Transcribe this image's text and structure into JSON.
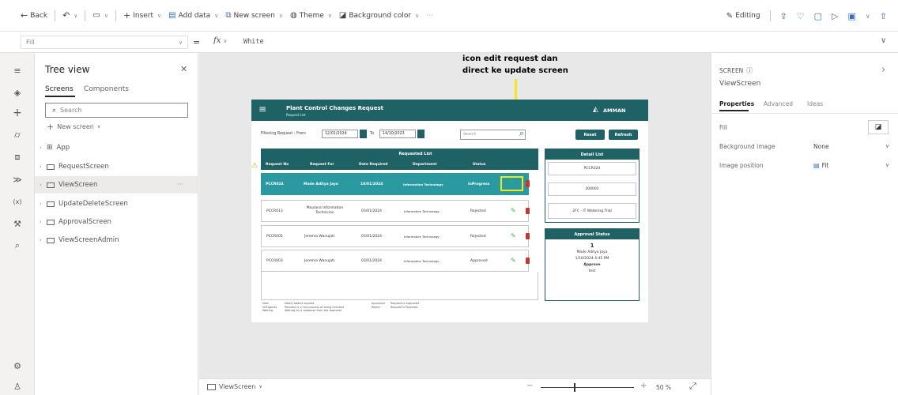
{
  "toolbar": {
    "back": "Back",
    "insert": "Insert",
    "add_data": "Add data",
    "new_screen": "New screen",
    "theme": "Theme",
    "background_color": "Background color",
    "editing": "Editing"
  },
  "formula": {
    "property": "Fill",
    "fx": "fx",
    "value": "White"
  },
  "tree": {
    "title": "Tree view",
    "tab_screens": "Screens",
    "tab_components": "Components",
    "search_placeholder": "Search",
    "new_screen": "New screen",
    "items": [
      {
        "label": "App"
      },
      {
        "label": "RequestScreen"
      },
      {
        "label": "ViewScreen"
      },
      {
        "label": "UpdateDeleteScreen"
      },
      {
        "label": "ApprovalScreen"
      },
      {
        "label": "ViewScreenAdmin"
      }
    ]
  },
  "annotation": {
    "line1": "icon edit request dan",
    "line2": "direct ke update screen"
  },
  "app": {
    "title": "Plant Control Changes Request",
    "subtitle": "Request List",
    "logo": "AMMAN",
    "filter_label": "Filtering Request : From",
    "date_from": "12/01/2024",
    "to_label": "To",
    "date_to": "14/10/2023",
    "search_placeholder": "Search",
    "reset": "Reset",
    "refresh": "Refresh",
    "list_title": "Requested List",
    "columns": [
      "Request No",
      "Request For",
      "Date Required",
      "Department",
      "Status"
    ],
    "rows": [
      {
        "no": "PCCR024",
        "for": "Made Aditya Jaya",
        "date": "10/01/2024",
        "dept": "Information Technology",
        "status": "InProgress"
      },
      {
        "no": "PCCR013",
        "for": "Maulana Information Technician",
        "date": "03/01/2024",
        "dept": "Information Technology",
        "status": "Rejected"
      },
      {
        "no": "PCCR005",
        "for": "Jeremia Wanujati",
        "date": "03/01/2024",
        "dept": "Information Technology",
        "status": "Rejected"
      },
      {
        "no": "PCCR003",
        "for": "Jeremia Wanujati",
        "date": "03/01/2024",
        "dept": "Information Technology",
        "status": "Approved"
      }
    ],
    "detail_title": "Detail List",
    "detail_items": [
      "PCCR024",
      "300001",
      "2FC - IT Watering Trial"
    ],
    "approval_title": "Approval Status",
    "approval_count": "1",
    "approval_name": "Made Aditya Jaya",
    "approval_date": "1/10/2024 4:45 PM",
    "approval_label": "Approve",
    "approval_value": "test",
    "legend_left": [
      "New",
      "InProgress",
      "Waiting"
    ],
    "legend_left_desc": [
      "Newly added request",
      "Request is in the process of being checked",
      "Waiting for a response from the Approver"
    ],
    "legend_right": [
      "Approved",
      "Reject"
    ],
    "legend_right_desc": [
      "Request is Approved",
      "Request is Rejected"
    ]
  },
  "status": {
    "screen": "ViewScreen",
    "zoom": "50 %"
  },
  "props": {
    "type": "SCREEN",
    "name": "ViewScreen",
    "tabs": [
      "Properties",
      "Advanced",
      "Ideas"
    ],
    "fill_label": "Fill",
    "bg_image_label": "Background image",
    "bg_image_value": "None",
    "img_pos_label": "Image position",
    "img_pos_value": "Fit"
  },
  "colors": {
    "header": "#1f6266",
    "annotation": "#f0e81a",
    "edit": "#3bb34a",
    "delete": "#c0392b"
  }
}
